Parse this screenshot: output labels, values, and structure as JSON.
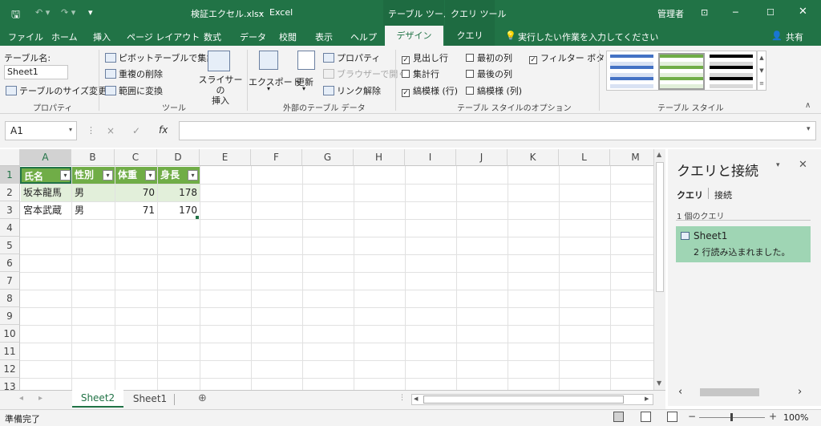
{
  "titlebar": {
    "save_icon": "save-icon",
    "undo_icon": "undo-icon",
    "redo_icon": "redo-icon",
    "filename": "検証エクセル.xlsx",
    "separator": "-",
    "app": "Excel",
    "context_table": "テーブル ツール",
    "context_query": "クエリ ツール",
    "user": "管理者"
  },
  "tabs": {
    "file": "ファイル",
    "home": "ホーム",
    "insert": "挿入",
    "pagelayout": "ページ レイアウト",
    "formulas": "数式",
    "data": "データ",
    "review": "校閲",
    "view": "表示",
    "help": "ヘルプ",
    "design": "デザイン",
    "query": "クエリ",
    "tellme": "実行したい作業を入力してください",
    "share": "共有"
  },
  "ribbon": {
    "props": {
      "name_label": "テーブル名:",
      "name_value": "Sheet1",
      "resize": "テーブルのサイズ変更",
      "group": "プロパティ"
    },
    "tools": {
      "pivot": "ピボットテーブルで集計",
      "dedupe": "重複の削除",
      "convert": "範囲に変換",
      "slicer1": "スライサーの",
      "slicer2": "挿入",
      "group": "ツール"
    },
    "external": {
      "export": "エクスポート",
      "refresh": "更新",
      "properties": "プロパティ",
      "browser": "ブラウザーで開く",
      "unlink": "リンク解除",
      "group": "外部のテーブル データ"
    },
    "options": {
      "header_row": "見出し行",
      "total_row": "集計行",
      "banded_rows": "縞模様 (行)",
      "first_col": "最初の列",
      "last_col": "最後の列",
      "banded_cols": "縞模様 (列)",
      "filter_btn": "フィルター ボタン",
      "group": "テーブル スタイルのオプション"
    },
    "styles": {
      "group": "テーブル スタイル"
    }
  },
  "formula": {
    "namebox": "A1",
    "cancel": "×",
    "enter": "✓",
    "fx": "fx",
    "value": ""
  },
  "sheet": {
    "columns": [
      "A",
      "B",
      "C",
      "D",
      "E",
      "F",
      "G",
      "H",
      "I",
      "J",
      "K",
      "L",
      "M"
    ],
    "rows": [
      "1",
      "2",
      "3",
      "4",
      "5",
      "6",
      "7",
      "8",
      "9",
      "10",
      "11",
      "12",
      "13"
    ],
    "header": [
      "氏名",
      "性別",
      "体重",
      "身長"
    ],
    "data": [
      [
        "坂本龍馬",
        "男",
        "70",
        "178"
      ],
      [
        "宮本武蔵",
        "男",
        "71",
        "170"
      ]
    ]
  },
  "pane": {
    "title": "クエリと接続",
    "tab_query": "クエリ",
    "tab_conn": "接続",
    "count": "1 個のクエリ",
    "query_name": "Sheet1",
    "query_status": "2 行読み込まれました。"
  },
  "sheets": {
    "tab1": "Sheet2",
    "tab2": "Sheet1"
  },
  "status": {
    "ready": "準備完了",
    "zoom": "100%"
  },
  "colors": {
    "excel_green": "#217346",
    "table_header": "#70ad47",
    "table_band": "#e2efda",
    "pane_selected": "#9fd5b4"
  }
}
